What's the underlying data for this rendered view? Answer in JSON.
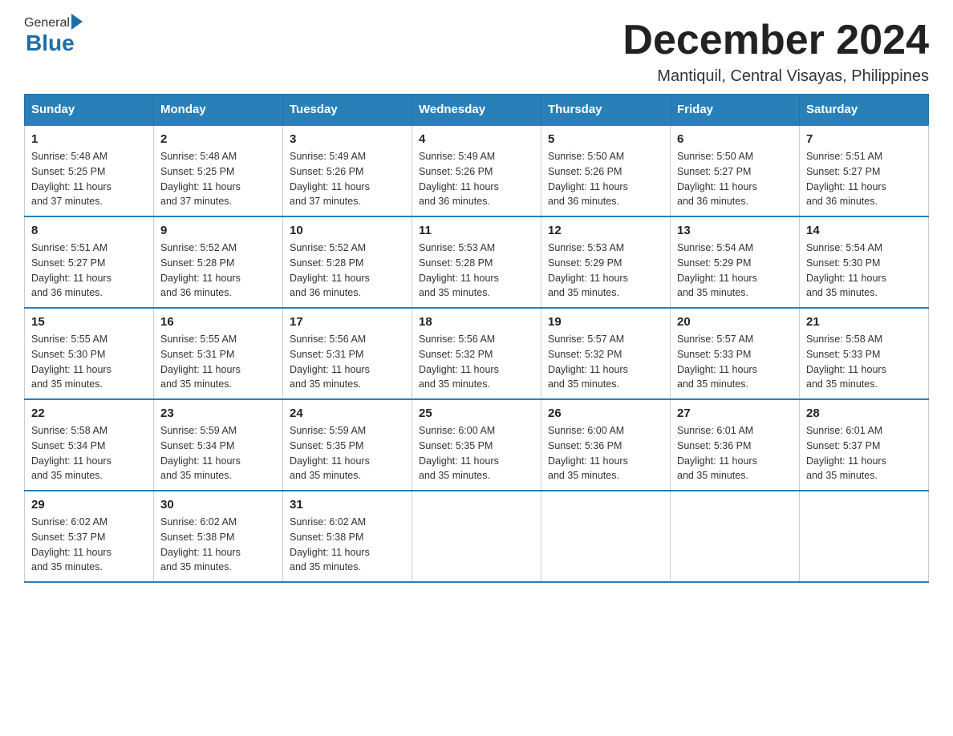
{
  "header": {
    "logo_general": "General",
    "logo_blue": "Blue",
    "month_year": "December 2024",
    "location": "Mantiquil, Central Visayas, Philippines"
  },
  "days_of_week": [
    "Sunday",
    "Monday",
    "Tuesday",
    "Wednesday",
    "Thursday",
    "Friday",
    "Saturday"
  ],
  "weeks": [
    [
      {
        "day": "1",
        "sunrise": "5:48 AM",
        "sunset": "5:25 PM",
        "daylight": "11 hours and 37 minutes."
      },
      {
        "day": "2",
        "sunrise": "5:48 AM",
        "sunset": "5:25 PM",
        "daylight": "11 hours and 37 minutes."
      },
      {
        "day": "3",
        "sunrise": "5:49 AM",
        "sunset": "5:26 PM",
        "daylight": "11 hours and 37 minutes."
      },
      {
        "day": "4",
        "sunrise": "5:49 AM",
        "sunset": "5:26 PM",
        "daylight": "11 hours and 36 minutes."
      },
      {
        "day": "5",
        "sunrise": "5:50 AM",
        "sunset": "5:26 PM",
        "daylight": "11 hours and 36 minutes."
      },
      {
        "day": "6",
        "sunrise": "5:50 AM",
        "sunset": "5:27 PM",
        "daylight": "11 hours and 36 minutes."
      },
      {
        "day": "7",
        "sunrise": "5:51 AM",
        "sunset": "5:27 PM",
        "daylight": "11 hours and 36 minutes."
      }
    ],
    [
      {
        "day": "8",
        "sunrise": "5:51 AM",
        "sunset": "5:27 PM",
        "daylight": "11 hours and 36 minutes."
      },
      {
        "day": "9",
        "sunrise": "5:52 AM",
        "sunset": "5:28 PM",
        "daylight": "11 hours and 36 minutes."
      },
      {
        "day": "10",
        "sunrise": "5:52 AM",
        "sunset": "5:28 PM",
        "daylight": "11 hours and 36 minutes."
      },
      {
        "day": "11",
        "sunrise": "5:53 AM",
        "sunset": "5:28 PM",
        "daylight": "11 hours and 35 minutes."
      },
      {
        "day": "12",
        "sunrise": "5:53 AM",
        "sunset": "5:29 PM",
        "daylight": "11 hours and 35 minutes."
      },
      {
        "day": "13",
        "sunrise": "5:54 AM",
        "sunset": "5:29 PM",
        "daylight": "11 hours and 35 minutes."
      },
      {
        "day": "14",
        "sunrise": "5:54 AM",
        "sunset": "5:30 PM",
        "daylight": "11 hours and 35 minutes."
      }
    ],
    [
      {
        "day": "15",
        "sunrise": "5:55 AM",
        "sunset": "5:30 PM",
        "daylight": "11 hours and 35 minutes."
      },
      {
        "day": "16",
        "sunrise": "5:55 AM",
        "sunset": "5:31 PM",
        "daylight": "11 hours and 35 minutes."
      },
      {
        "day": "17",
        "sunrise": "5:56 AM",
        "sunset": "5:31 PM",
        "daylight": "11 hours and 35 minutes."
      },
      {
        "day": "18",
        "sunrise": "5:56 AM",
        "sunset": "5:32 PM",
        "daylight": "11 hours and 35 minutes."
      },
      {
        "day": "19",
        "sunrise": "5:57 AM",
        "sunset": "5:32 PM",
        "daylight": "11 hours and 35 minutes."
      },
      {
        "day": "20",
        "sunrise": "5:57 AM",
        "sunset": "5:33 PM",
        "daylight": "11 hours and 35 minutes."
      },
      {
        "day": "21",
        "sunrise": "5:58 AM",
        "sunset": "5:33 PM",
        "daylight": "11 hours and 35 minutes."
      }
    ],
    [
      {
        "day": "22",
        "sunrise": "5:58 AM",
        "sunset": "5:34 PM",
        "daylight": "11 hours and 35 minutes."
      },
      {
        "day": "23",
        "sunrise": "5:59 AM",
        "sunset": "5:34 PM",
        "daylight": "11 hours and 35 minutes."
      },
      {
        "day": "24",
        "sunrise": "5:59 AM",
        "sunset": "5:35 PM",
        "daylight": "11 hours and 35 minutes."
      },
      {
        "day": "25",
        "sunrise": "6:00 AM",
        "sunset": "5:35 PM",
        "daylight": "11 hours and 35 minutes."
      },
      {
        "day": "26",
        "sunrise": "6:00 AM",
        "sunset": "5:36 PM",
        "daylight": "11 hours and 35 minutes."
      },
      {
        "day": "27",
        "sunrise": "6:01 AM",
        "sunset": "5:36 PM",
        "daylight": "11 hours and 35 minutes."
      },
      {
        "day": "28",
        "sunrise": "6:01 AM",
        "sunset": "5:37 PM",
        "daylight": "11 hours and 35 minutes."
      }
    ],
    [
      {
        "day": "29",
        "sunrise": "6:02 AM",
        "sunset": "5:37 PM",
        "daylight": "11 hours and 35 minutes."
      },
      {
        "day": "30",
        "sunrise": "6:02 AM",
        "sunset": "5:38 PM",
        "daylight": "11 hours and 35 minutes."
      },
      {
        "day": "31",
        "sunrise": "6:02 AM",
        "sunset": "5:38 PM",
        "daylight": "11 hours and 35 minutes."
      },
      null,
      null,
      null,
      null
    ]
  ],
  "labels": {
    "sunrise": "Sunrise:",
    "sunset": "Sunset:",
    "daylight": "Daylight:"
  }
}
